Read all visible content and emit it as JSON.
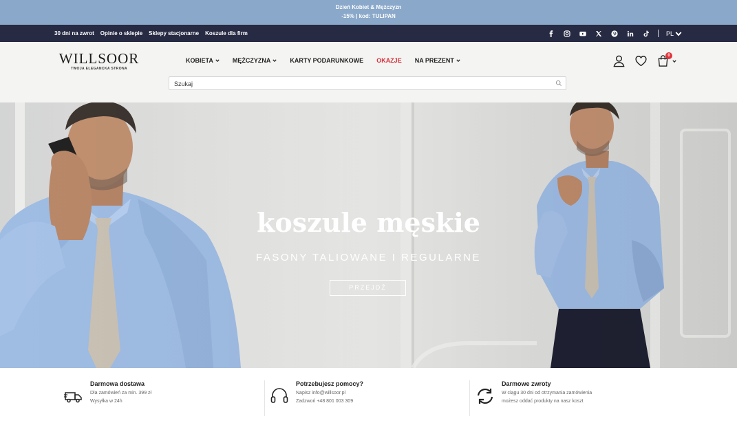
{
  "promo": {
    "line1": "Dzień Kobiet & Mężczyzn",
    "line2": "-15% | kod: TULIPAN"
  },
  "topbar": {
    "links": [
      "30 dni na zwrot",
      "Opinie o sklepie",
      "Sklepy stacjonarne",
      "Koszule dla firm"
    ],
    "socials": [
      "facebook-icon",
      "instagram-icon",
      "youtube-icon",
      "x-icon",
      "pinterest-icon",
      "linkedin-icon",
      "tiktok-icon"
    ],
    "language": "PL"
  },
  "header": {
    "logo_word": "WILLSOOR",
    "logo_tagline": "TWOJA ELEGANCKA STRONA",
    "nav": [
      {
        "label": "KOBIETA",
        "dropdown": true
      },
      {
        "label": "MĘŻCZYZNA",
        "dropdown": true
      },
      {
        "label": "KARTY PODARUNKOWE",
        "dropdown": false
      },
      {
        "label": "OKAZJE",
        "dropdown": false,
        "highlight": "#d6303b"
      },
      {
        "label": "NA PREZENT",
        "dropdown": true
      }
    ],
    "search_placeholder": "Szukaj",
    "cart_count": "0"
  },
  "hero": {
    "title": "koszule męskie",
    "subtitle": "FASONY TALIOWANE I REGULARNE",
    "button": "PRZEJDŹ"
  },
  "features": [
    {
      "icon": "delivery-truck-icon",
      "title": "Darmowa dostawa",
      "line1": "Dla zamówień za min. 399 zł",
      "line2": "Wysyłka w 24h"
    },
    {
      "icon": "headset-icon",
      "title": "Potrzebujesz pomocy?",
      "line1": "Napisz  info@willsoor.pl",
      "line2": "Zadzwoń  +48 801 003 309"
    },
    {
      "icon": "return-arrows-icon",
      "title": "Darmowe zwroty",
      "line1": "W ciągu 30 dni od otrzymania zamówienia",
      "line2": "możesz oddać produkty na nasz koszt"
    }
  ],
  "colors": {
    "promo_bg": "#8aa8c9",
    "topbar_bg": "#262a43",
    "sale_red": "#d6303b"
  }
}
